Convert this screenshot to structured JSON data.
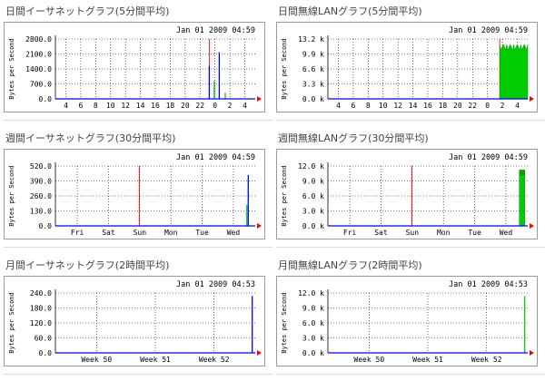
{
  "panels": [
    {
      "title": "日間イーサネットグラフ(5分間平均)",
      "timestamp": "Jan 01 2009 04:59",
      "ylabel": "Bytes per Second",
      "yticks": [
        "2800.0",
        "2100.0",
        "1400.0",
        "700.0",
        "0.0"
      ],
      "xticks": [
        "4",
        "6",
        "8",
        "10",
        "12",
        "14",
        "16",
        "18",
        "20",
        "22",
        "0",
        "2",
        "4"
      ]
    },
    {
      "title": "日間無線LANグラフ(5分間平均)",
      "timestamp": "Jan 01 2009 04:59",
      "ylabel": "Bytes per Second",
      "yticks": [
        "13.2 k",
        "9.9 k",
        "6.6 k",
        "3.3 k",
        "0.0 k"
      ],
      "xticks": [
        "4",
        "6",
        "8",
        "10",
        "12",
        "14",
        "16",
        "18",
        "20",
        "22",
        "0",
        "2",
        "4"
      ]
    },
    {
      "title": "週間イーサネットグラフ(30分間平均)",
      "timestamp": "Jan 01 2009 04:59",
      "ylabel": "Bytes per Second",
      "yticks": [
        "520.0",
        "390.0",
        "260.0",
        "130.0",
        "0.0"
      ],
      "xticks": [
        "Fri",
        "Sat",
        "Sun",
        "Mon",
        "Tue",
        "Wed"
      ]
    },
    {
      "title": "週間無線LANグラフ(30分間平均)",
      "timestamp": "Jan 01 2009 04:59",
      "ylabel": "Bytes per Second",
      "yticks": [
        "12.0 k",
        "9.0 k",
        "6.0 k",
        "3.0 k",
        "0.0 k"
      ],
      "xticks": [
        "Fri",
        "Sat",
        "Sun",
        "Mon",
        "Tue",
        "Wed"
      ]
    },
    {
      "title": "月間イーサネットグラフ(2時間平均)",
      "timestamp": "Jan 01 2009 04:53",
      "ylabel": "Bytes per Second",
      "yticks": [
        "240.0",
        "180.0",
        "120.0",
        "60.0",
        "0.0"
      ],
      "xticks": [
        "Week 50",
        "Week 51",
        "Week 52"
      ]
    },
    {
      "title": "月間無線LANグラフ(2時間平均)",
      "timestamp": "Jan 01 2009 04:53",
      "ylabel": "Bytes per Second",
      "yticks": [
        "12.0 k",
        "9.0 k",
        "6.0 k",
        "3.0 k",
        "0.0 k"
      ],
      "xticks": [
        "Week 50",
        "Week 51",
        "Week 52"
      ]
    }
  ],
  "colors": {
    "accent": "#ff0000",
    "inbound": "#00cc00",
    "outbound": "#0000ff",
    "grid": "#000000"
  }
}
